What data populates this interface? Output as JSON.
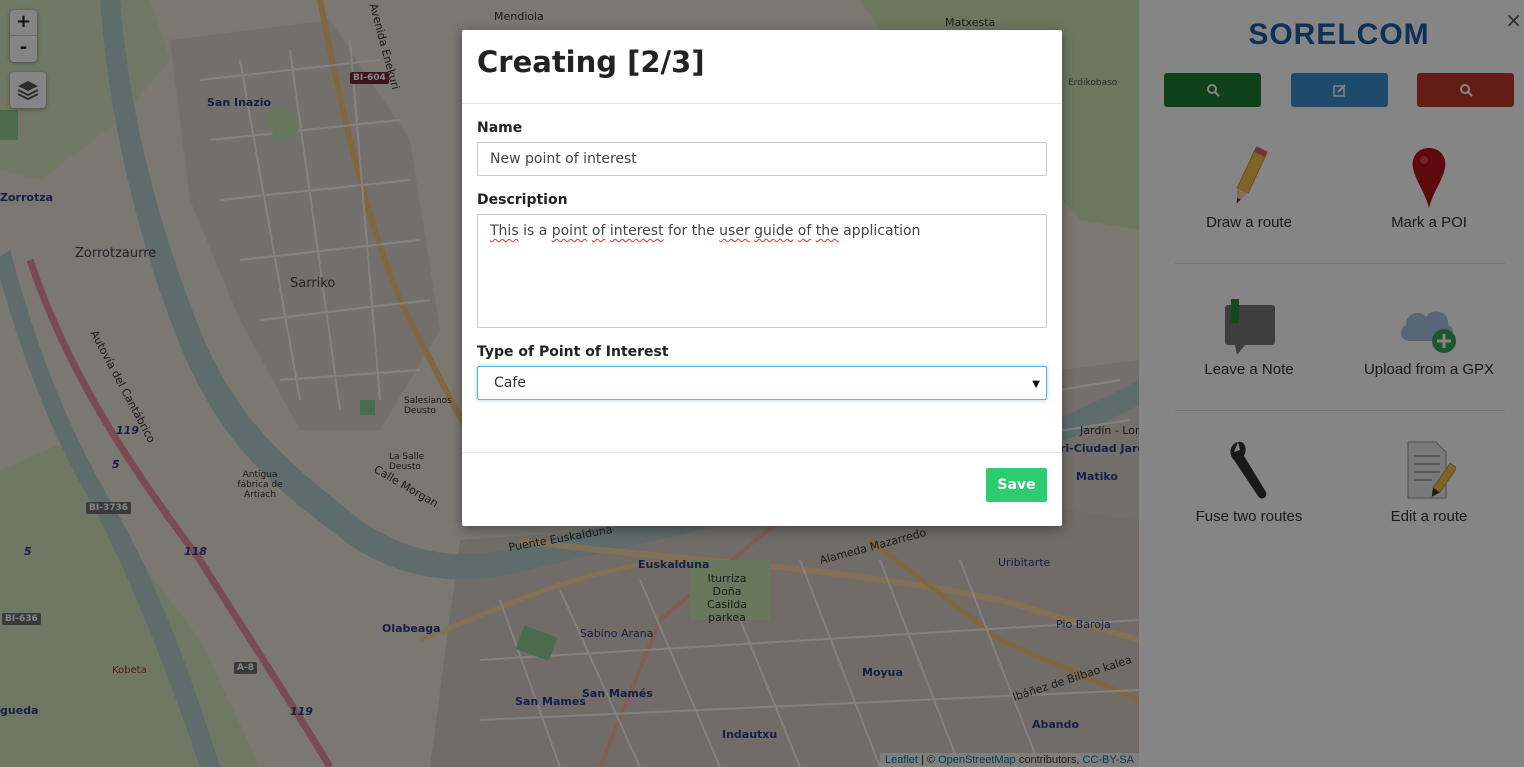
{
  "map": {
    "zoom_in": "+",
    "zoom_out": "-",
    "labels": {
      "mendiola": "Mendiola",
      "matxesta": "Matxesta",
      "san_inazio": "San Inazio",
      "zorrotza": "Zorrotza",
      "zorrotzaurre": "Zorrotzaurre",
      "sarriko": "Sarriko",
      "salesianos": "Salesianos Deusto",
      "la_salle": "La Salle Deusto",
      "olabeaga": "Olabeaga",
      "kobeta": "Kobeta",
      "euskalduna": "Euskalduna",
      "iturriza": "Iturriza Doña Casilda parkea",
      "sabino_arana": "Sabino Arana",
      "san_mames": "San Mames",
      "san_mames_2": "San Mamés",
      "indautxu": "Indautxu",
      "moyua": "Moyua",
      "abando": "Abando",
      "matiko": "Matiko",
      "ciudad_jardin": "ri-Ciudad Jardi",
      "jardin_loru": "Jardín - Loru",
      "erdikobaso": "Erdikobaso",
      "uribitarte": "Uribitarte",
      "pio_baroja": "Pio Baroja",
      "alameda_mazarredo": "Alameda Mazarredo",
      "ibanez": "Ibáñez de Bilbao kalea",
      "puente": "Puente Euskalduna",
      "calle_morgan": "Calle Morgan",
      "autovia": "Autovía del Cantábrico",
      "antigua_fabrica": "Antigua fábrica de Artiach",
      "avenida_enekuri": "Avenida Enekuri",
      "aguada": "gueda"
    },
    "shields": {
      "bi604": "BI-604",
      "bi3736": "BI-3736",
      "bi636": "BI-636",
      "a8": "A-8",
      "r119a": "119",
      "r119b": "119",
      "r118": "118",
      "r5a": "5",
      "r5b": "5"
    },
    "attribution": {
      "leaflet": "Leaflet",
      "sep": "| ©",
      "osm": "OpenStreetMap",
      "contributors": "contributors,",
      "license": "CC-BY-SA"
    }
  },
  "sidebar": {
    "brand": "SORELCOM",
    "close": "×",
    "tools": {
      "draw_route": "Draw a route",
      "mark_poi": "Mark a POI",
      "leave_note": "Leave a Note",
      "upload_gpx": "Upload from a GPX",
      "fuse_routes": "Fuse two routes",
      "edit_route": "Edit a route"
    },
    "colors": {
      "green": "#1e7e34",
      "blue": "#3b8fd0",
      "red": "#c0392b",
      "brand": "#1c5ea8"
    }
  },
  "modal": {
    "title": "Creating [2/3]",
    "name_label": "Name",
    "name_value": "New point of interest",
    "description_label": "Description",
    "description_parts": {
      "p1": "This",
      "p2": "is a",
      "p3": "point",
      "p4": "of",
      "p5": "interest",
      "p6": "for the",
      "p7": "user",
      "p8": "guide",
      "p9": "of",
      "p10": "the",
      "p11": "application"
    },
    "type_label": "Type of Point of Interest",
    "type_value": "Cafe",
    "save_label": "Save",
    "save_color": "#2ecc71"
  }
}
